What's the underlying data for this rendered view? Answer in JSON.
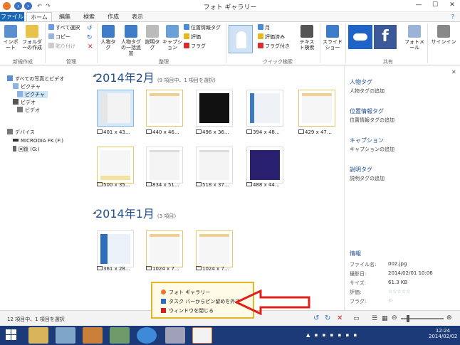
{
  "window": {
    "title": "フォト ギャラリー"
  },
  "tabs": [
    {
      "label": "ファイル"
    },
    {
      "label": "ホーム"
    },
    {
      "label": "編集"
    },
    {
      "label": "検索"
    },
    {
      "label": "作成"
    },
    {
      "label": "表示"
    }
  ],
  "ribbon": {
    "import_label": "インポート",
    "folder_label": "フォルダーの作成",
    "group_new": "新規作成",
    "select_all": "すべて選択",
    "copy": "コピー",
    "paste": "貼り付け",
    "group_manage": "管理",
    "person_tag": "人物タグ",
    "person_bulk": "人物タグの一括追加",
    "desc_tag": "説明タグ",
    "caption": "キャプション",
    "geotag": "位置情報タグ",
    "rating": "評価",
    "flag": "フラグ",
    "group_organize": "整理",
    "month": "月",
    "rated": "評価済み",
    "flagged": "フラグ付き",
    "text_search": "テキスト検索",
    "group_quick": "クイック検索",
    "slideshow": "スライドショー",
    "photo_mail": "フォトメール",
    "signin": "サインイン",
    "group_share": "共有"
  },
  "nav": {
    "all_photos": "すべての写真とビデオ",
    "pictures": "ピクチャ",
    "pictures_sub": "ピクチャ",
    "videos": "ビデオ",
    "videos_sub": "ビデオ",
    "devices": "デバイス",
    "drive1": "MICRODIA FK (F:)",
    "drive2": "回復 (G:)"
  },
  "groups": [
    {
      "title": "2014年2月",
      "count": "(9 項目中、1 項目を選択)"
    },
    {
      "title": "2014年1月",
      "count": "(3 項目)"
    }
  ],
  "feb_thumbs": [
    {
      "caption": "401 x 43…"
    },
    {
      "caption": "440 x 46…"
    },
    {
      "caption": "496 x 36…"
    },
    {
      "caption": "394 x 48…"
    },
    {
      "caption": "429 x 47…"
    },
    {
      "caption": "500 x 35…"
    },
    {
      "caption": "834 x 51…"
    },
    {
      "caption": "518 x 37…"
    },
    {
      "caption": "488 x 44…"
    }
  ],
  "jan_thumbs": [
    {
      "caption": "361 x 28…"
    },
    {
      "caption": "1024 x 7…"
    },
    {
      "caption": "1024 x 7…"
    }
  ],
  "panel": {
    "person_tag_h": "人物タグ",
    "person_tag_add": "人物タグの追加",
    "geo_h": "位置情報タグ",
    "geo_add": "位置情報タグの追加",
    "caption_h": "キャプション",
    "caption_add": "キャプションの追加",
    "desc_h": "説明タグ",
    "desc_add": "説明タグの追加",
    "info_h": "情報",
    "info": [
      {
        "k": "ファイル名:",
        "v": "002.jpg"
      },
      {
        "k": "撮影日:",
        "v": "2014/02/01  10:06"
      },
      {
        "k": "サイズ:",
        "v": "61.3 KB"
      },
      {
        "k": "評価:",
        "v": "☆☆☆☆☆"
      },
      {
        "k": "フラグ:",
        "v": "⚐"
      }
    ]
  },
  "status": {
    "text": "12 項目中、1 項目を選択"
  },
  "jumplist": {
    "item1": "フォト ギャラリー",
    "item2": "タスク バーからピン留めを外す",
    "item3": "ウィンドウを閉じる"
  },
  "clock": {
    "time": "12:24",
    "date": "2014/02/02"
  },
  "colors": {
    "accent": "#1b69b6",
    "taskbar": "#1c3a78",
    "arrow": "#e0201a",
    "popup_border": "#e2b628"
  }
}
